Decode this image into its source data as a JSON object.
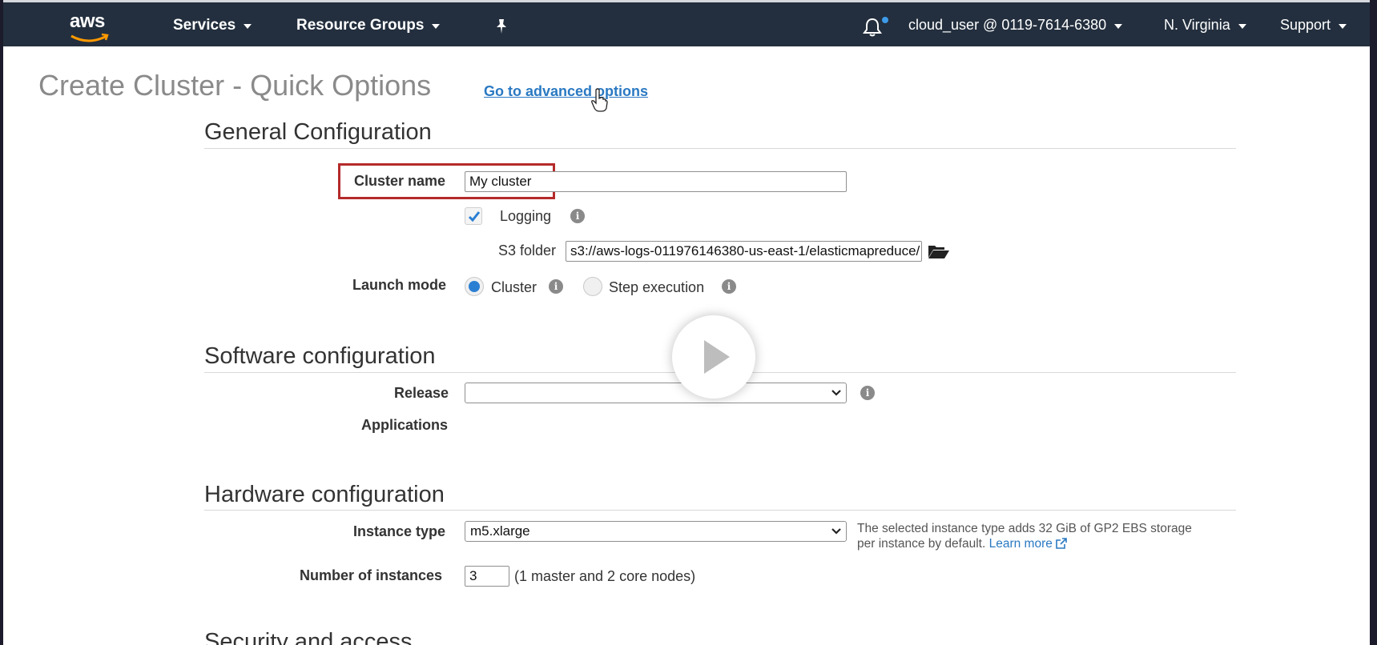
{
  "topbar": {
    "logo": "aws",
    "services": "Services",
    "resource_groups": "Resource Groups",
    "account": "cloud_user @ 0119-7614-6380",
    "region": "N. Virginia",
    "support": "Support"
  },
  "page": {
    "title": "Create Cluster - Quick Options",
    "advanced_link": "Go to advanced options"
  },
  "general": {
    "title": "General Configuration",
    "cluster_name_label": "Cluster name",
    "cluster_name_value": "My cluster",
    "logging_label": "Logging",
    "logging_checked": true,
    "s3_label": "S3 folder",
    "s3_value": "s3://aws-logs-011976146380-us-east-1/elasticmapreduce/",
    "launch_mode_label": "Launch mode",
    "launch_modes": [
      "Cluster",
      "Step execution"
    ],
    "launch_mode_selected": "Cluster"
  },
  "software": {
    "title": "Software configuration",
    "release_label": "Release",
    "release_value": "",
    "applications_label": "Applications"
  },
  "hardware": {
    "title": "Hardware configuration",
    "instance_type_label": "Instance type",
    "instance_type_value": "m5.xlarge",
    "instance_help": "The selected instance type adds 32 GiB of GP2 EBS storage per instance by default.",
    "learn_more": "Learn more",
    "num_instances_label": "Number of instances",
    "num_instances_value": "3",
    "num_instances_note": "(1 master and 2 core nodes)"
  },
  "security": {
    "title": "Security and access"
  },
  "colors": {
    "nav_bg": "#232f3e",
    "link": "#2a79c2",
    "highlight": "#b52a2a",
    "radio_on": "#2b7fd3"
  }
}
